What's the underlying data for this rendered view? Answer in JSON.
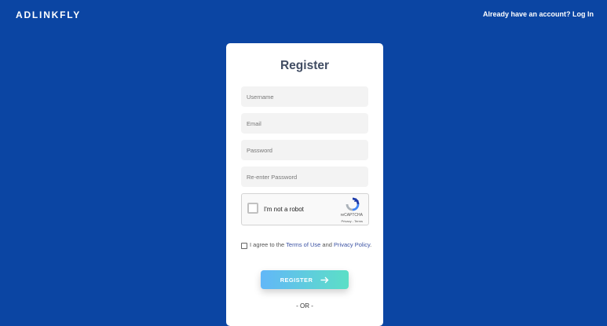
{
  "header": {
    "brand": "ADLINKFLY",
    "login_link": "Already have an account? Log In"
  },
  "form": {
    "title": "Register",
    "fields": [
      {
        "placeholder": "Username",
        "value": ""
      },
      {
        "placeholder": "Email",
        "value": ""
      },
      {
        "placeholder": "Password",
        "value": ""
      },
      {
        "placeholder": "Re-enter Password",
        "value": ""
      }
    ],
    "captcha": {
      "label": "I'm not a robot",
      "brand": "reCAPTCHA",
      "privacy": "Privacy",
      "separator": " - ",
      "terms": "Terms",
      "icon": "recaptcha-logo-icon"
    },
    "agree": {
      "prefix": "I agree to the ",
      "terms_link": "Terms of Use",
      "middle": " and ",
      "privacy_link": "Privacy Policy",
      "suffix": ".",
      "checked": false
    },
    "submit_label": "REGISTER",
    "submit_icon": "arrow-right-icon",
    "divider": "- OR -"
  },
  "colors": {
    "background": "#0b45a3",
    "card": "#ffffff",
    "button_gradient_start": "#62b7f8",
    "button_gradient_end": "#5cdfc6",
    "link": "#3b52a3"
  }
}
